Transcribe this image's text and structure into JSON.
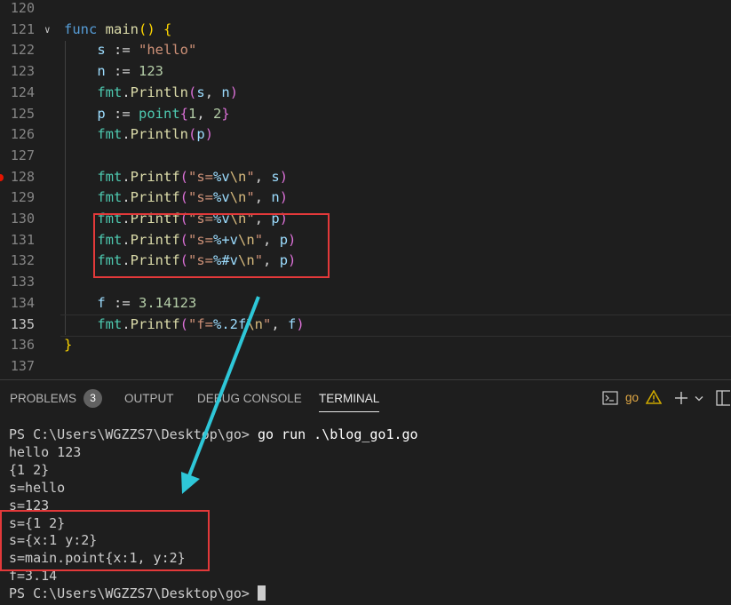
{
  "editor": {
    "lines": [
      {
        "num": "120",
        "tokens": []
      },
      {
        "num": "121",
        "tokens": [
          {
            "t": "func",
            "c": "k"
          },
          {
            "t": " ",
            "c": "p"
          },
          {
            "t": "main",
            "c": "f"
          },
          {
            "t": "()",
            "c": "b1"
          },
          {
            "t": " ",
            "c": "p"
          },
          {
            "t": "{",
            "c": "b1"
          }
        ]
      },
      {
        "num": "122",
        "tokens": [
          {
            "t": "    s",
            "c": "v"
          },
          {
            "t": " := ",
            "c": "p"
          },
          {
            "t": "\"hello\"",
            "c": "s"
          }
        ]
      },
      {
        "num": "123",
        "tokens": [
          {
            "t": "    n",
            "c": "v"
          },
          {
            "t": " := ",
            "c": "p"
          },
          {
            "t": "123",
            "c": "n"
          }
        ]
      },
      {
        "num": "124",
        "tokens": [
          {
            "t": "    fmt",
            "c": "t"
          },
          {
            "t": ".",
            "c": "p"
          },
          {
            "t": "Println",
            "c": "f"
          },
          {
            "t": "(",
            "c": "b2"
          },
          {
            "t": "s",
            "c": "v"
          },
          {
            "t": ", ",
            "c": "p"
          },
          {
            "t": "n",
            "c": "v"
          },
          {
            "t": ")",
            "c": "b2"
          }
        ]
      },
      {
        "num": "125",
        "tokens": [
          {
            "t": "    p",
            "c": "v"
          },
          {
            "t": " := ",
            "c": "p"
          },
          {
            "t": "point",
            "c": "t"
          },
          {
            "t": "{",
            "c": "b2"
          },
          {
            "t": "1",
            "c": "n"
          },
          {
            "t": ", ",
            "c": "p"
          },
          {
            "t": "2",
            "c": "n"
          },
          {
            "t": "}",
            "c": "b2"
          }
        ]
      },
      {
        "num": "126",
        "tokens": [
          {
            "t": "    fmt",
            "c": "t"
          },
          {
            "t": ".",
            "c": "p"
          },
          {
            "t": "Println",
            "c": "f"
          },
          {
            "t": "(",
            "c": "b2"
          },
          {
            "t": "p",
            "c": "v"
          },
          {
            "t": ")",
            "c": "b2"
          }
        ]
      },
      {
        "num": "127",
        "tokens": []
      },
      {
        "num": "128",
        "breakpoint": true,
        "tokens": [
          {
            "t": "    fmt",
            "c": "t"
          },
          {
            "t": ".",
            "c": "p"
          },
          {
            "t": "Printf",
            "c": "f"
          },
          {
            "t": "(",
            "c": "b2"
          },
          {
            "t": "\"s=",
            "c": "s"
          },
          {
            "t": "%v",
            "c": "v"
          },
          {
            "t": "\\n",
            "c": "e"
          },
          {
            "t": "\"",
            "c": "s"
          },
          {
            "t": ", ",
            "c": "p"
          },
          {
            "t": "s",
            "c": "v"
          },
          {
            "t": ")",
            "c": "b2"
          }
        ]
      },
      {
        "num": "129",
        "tokens": [
          {
            "t": "    fmt",
            "c": "t"
          },
          {
            "t": ".",
            "c": "p"
          },
          {
            "t": "Printf",
            "c": "f"
          },
          {
            "t": "(",
            "c": "b2"
          },
          {
            "t": "\"s=",
            "c": "s"
          },
          {
            "t": "%v",
            "c": "v"
          },
          {
            "t": "\\n",
            "c": "e"
          },
          {
            "t": "\"",
            "c": "s"
          },
          {
            "t": ", ",
            "c": "p"
          },
          {
            "t": "n",
            "c": "v"
          },
          {
            "t": ")",
            "c": "b2"
          }
        ]
      },
      {
        "num": "130",
        "tokens": [
          {
            "t": "    fmt",
            "c": "t"
          },
          {
            "t": ".",
            "c": "p"
          },
          {
            "t": "Printf",
            "c": "f"
          },
          {
            "t": "(",
            "c": "b2"
          },
          {
            "t": "\"s=",
            "c": "s"
          },
          {
            "t": "%v",
            "c": "v"
          },
          {
            "t": "\\n",
            "c": "e"
          },
          {
            "t": "\"",
            "c": "s"
          },
          {
            "t": ", ",
            "c": "p"
          },
          {
            "t": "p",
            "c": "v"
          },
          {
            "t": ")",
            "c": "b2"
          }
        ]
      },
      {
        "num": "131",
        "tokens": [
          {
            "t": "    fmt",
            "c": "t"
          },
          {
            "t": ".",
            "c": "p"
          },
          {
            "t": "Printf",
            "c": "f"
          },
          {
            "t": "(",
            "c": "b2"
          },
          {
            "t": "\"s=",
            "c": "s"
          },
          {
            "t": "%+v",
            "c": "v"
          },
          {
            "t": "\\n",
            "c": "e"
          },
          {
            "t": "\"",
            "c": "s"
          },
          {
            "t": ", ",
            "c": "p"
          },
          {
            "t": "p",
            "c": "v"
          },
          {
            "t": ")",
            "c": "b2"
          }
        ]
      },
      {
        "num": "132",
        "tokens": [
          {
            "t": "    fmt",
            "c": "t"
          },
          {
            "t": ".",
            "c": "p"
          },
          {
            "t": "Printf",
            "c": "f"
          },
          {
            "t": "(",
            "c": "b2"
          },
          {
            "t": "\"s=",
            "c": "s"
          },
          {
            "t": "%#v",
            "c": "v"
          },
          {
            "t": "\\n",
            "c": "e"
          },
          {
            "t": "\"",
            "c": "s"
          },
          {
            "t": ", ",
            "c": "p"
          },
          {
            "t": "p",
            "c": "v"
          },
          {
            "t": ")",
            "c": "b2"
          }
        ]
      },
      {
        "num": "133",
        "tokens": []
      },
      {
        "num": "134",
        "tokens": [
          {
            "t": "    f",
            "c": "v"
          },
          {
            "t": " := ",
            "c": "p"
          },
          {
            "t": "3.14123",
            "c": "n"
          }
        ]
      },
      {
        "num": "135",
        "active": true,
        "tokens": [
          {
            "t": "    fmt",
            "c": "t"
          },
          {
            "t": ".",
            "c": "p"
          },
          {
            "t": "Printf",
            "c": "f"
          },
          {
            "t": "(",
            "c": "b2"
          },
          {
            "t": "\"f=",
            "c": "s"
          },
          {
            "t": "%.2f",
            "c": "v"
          },
          {
            "t": "\\n",
            "c": "e"
          },
          {
            "t": "\"",
            "c": "s"
          },
          {
            "t": ", ",
            "c": "p"
          },
          {
            "t": "f",
            "c": "v"
          },
          {
            "t": ")",
            "c": "b2"
          }
        ]
      },
      {
        "num": "136",
        "tokens": [
          {
            "t": "}",
            "c": "b1"
          }
        ]
      },
      {
        "num": "137",
        "tokens": []
      }
    ]
  },
  "panel": {
    "tabs": {
      "problems": "PROBLEMS",
      "problems_count": "3",
      "output": "OUTPUT",
      "debug": "DEBUG CONSOLE",
      "terminal": "TERMINAL"
    },
    "terminal_profile": "go",
    "terminal_icon": "terminal-icon",
    "warning_icon": "warning-icon",
    "add_icon": "plus-icon",
    "dropdown_icon": "chevron-down-icon",
    "split_icon": "split-panel-icon"
  },
  "terminal": {
    "prompt": "PS C:\\Users\\WGZZS7\\Desktop\\go> ",
    "command": "go run .\\blog_go1.go",
    "output": [
      "hello 123",
      "{1 2}",
      "s=hello",
      "s=123",
      "s={1 2}",
      "s={x:1 y:2}",
      "s=main.point{x:1, y:2}",
      "f=3.14"
    ],
    "final_prompt": "PS C:\\Users\\WGZZS7\\Desktop\\go> "
  },
  "colors": {
    "annotation_red": "#e3393a",
    "annotation_arrow": "#2ec7d8",
    "warning_orange": "#cca700",
    "go_profile": "#e2a945"
  }
}
